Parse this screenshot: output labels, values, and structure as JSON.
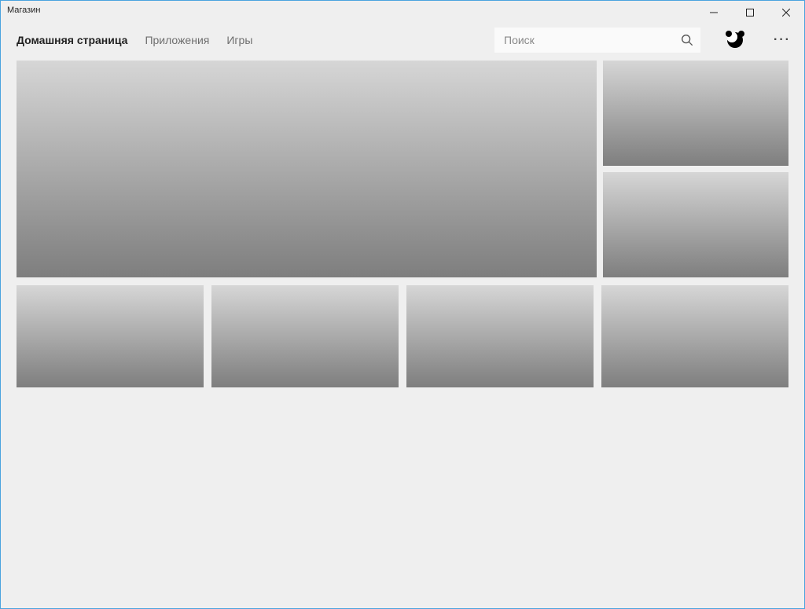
{
  "window": {
    "title": "Магазин"
  },
  "nav": {
    "items": [
      {
        "label": "Домашняя страница",
        "active": true
      },
      {
        "label": "Приложения",
        "active": false
      },
      {
        "label": "Игры",
        "active": false
      }
    ]
  },
  "search": {
    "placeholder": "Поиск"
  },
  "more": {
    "glyph": "···"
  }
}
